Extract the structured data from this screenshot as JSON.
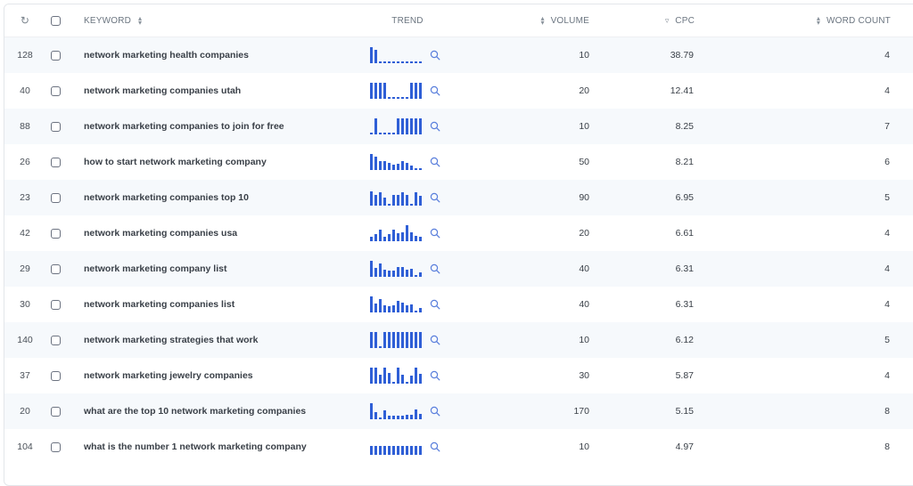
{
  "header": {
    "refresh_icon": "refresh-icon",
    "keyword": "KEYWORD",
    "trend": "TREND",
    "volume": "VOLUME",
    "cpc": "CPC",
    "word_count": "WORD COUNT"
  },
  "colors": {
    "bar": "#2f5fd6",
    "row_alt": "#f6f9fc",
    "header_text": "#6b7580"
  },
  "rows": [
    {
      "idx": "128",
      "keyword": "network marketing health companies",
      "volume": "10",
      "cpc": "38.79",
      "words": "4",
      "trend": [
        1,
        0.85,
        0.08,
        0.08,
        0.08,
        0.08,
        0.08,
        0.08,
        0.08,
        0.08,
        0.08,
        0.08
      ]
    },
    {
      "idx": "40",
      "keyword": "network marketing companies utah",
      "volume": "20",
      "cpc": "12.41",
      "words": "4",
      "trend": [
        1,
        1,
        1,
        1,
        0.08,
        0.08,
        0.08,
        0.08,
        0.08,
        1,
        1,
        1
      ]
    },
    {
      "idx": "88",
      "keyword": "network marketing companies to join for free",
      "volume": "10",
      "cpc": "8.25",
      "words": "7",
      "trend": [
        0.08,
        1,
        0.08,
        0.08,
        0.08,
        0.08,
        1,
        1,
        1,
        1,
        1,
        1
      ]
    },
    {
      "idx": "26",
      "keyword": "how to start network marketing company",
      "volume": "50",
      "cpc": "8.21",
      "words": "6",
      "trend": [
        1,
        0.85,
        0.55,
        0.55,
        0.45,
        0.35,
        0.4,
        0.55,
        0.45,
        0.3,
        0.08,
        0.08
      ]
    },
    {
      "idx": "23",
      "keyword": "network marketing companies top 10",
      "volume": "90",
      "cpc": "6.95",
      "words": "5",
      "trend": [
        0.9,
        0.65,
        0.85,
        0.5,
        0.08,
        0.65,
        0.65,
        0.85,
        0.65,
        0.08,
        0.85,
        0.6
      ]
    },
    {
      "idx": "42",
      "keyword": "network marketing companies usa",
      "volume": "20",
      "cpc": "6.61",
      "words": "4",
      "trend": [
        0.3,
        0.45,
        0.7,
        0.25,
        0.45,
        0.7,
        0.5,
        0.55,
        1,
        0.55,
        0.35,
        0.3
      ]
    },
    {
      "idx": "29",
      "keyword": "network marketing company list",
      "volume": "40",
      "cpc": "6.31",
      "words": "4",
      "trend": [
        1,
        0.55,
        0.85,
        0.45,
        0.4,
        0.4,
        0.6,
        0.6,
        0.45,
        0.5,
        0.08,
        0.3
      ]
    },
    {
      "idx": "30",
      "keyword": "network marketing companies list",
      "volume": "40",
      "cpc": "6.31",
      "words": "4",
      "trend": [
        1,
        0.55,
        0.85,
        0.45,
        0.4,
        0.45,
        0.7,
        0.6,
        0.45,
        0.5,
        0.08,
        0.3
      ]
    },
    {
      "idx": "140",
      "keyword": "network marketing strategies that work",
      "volume": "10",
      "cpc": "6.12",
      "words": "5",
      "trend": [
        1,
        1,
        0.08,
        1,
        1,
        1,
        1,
        1,
        1,
        1,
        1,
        1
      ]
    },
    {
      "idx": "37",
      "keyword": "network marketing jewelry companies",
      "volume": "30",
      "cpc": "5.87",
      "words": "4",
      "trend": [
        1,
        1,
        0.55,
        1,
        0.65,
        0.08,
        1,
        0.55,
        0.08,
        0.5,
        1,
        0.6
      ]
    },
    {
      "idx": "20",
      "keyword": "what are the top 10 network marketing companies",
      "volume": "170",
      "cpc": "5.15",
      "words": "8",
      "trend": [
        1,
        0.45,
        0.08,
        0.55,
        0.2,
        0.2,
        0.2,
        0.2,
        0.3,
        0.3,
        0.6,
        0.35
      ]
    },
    {
      "idx": "104",
      "keyword": "what is the number 1 network marketing company",
      "volume": "10",
      "cpc": "4.97",
      "words": "8",
      "trend": [
        0.55,
        0.55,
        0.55,
        0.55,
        0.55,
        0.55,
        0.55,
        0.55,
        0.55,
        0.55,
        0.55,
        0.55
      ]
    }
  ]
}
